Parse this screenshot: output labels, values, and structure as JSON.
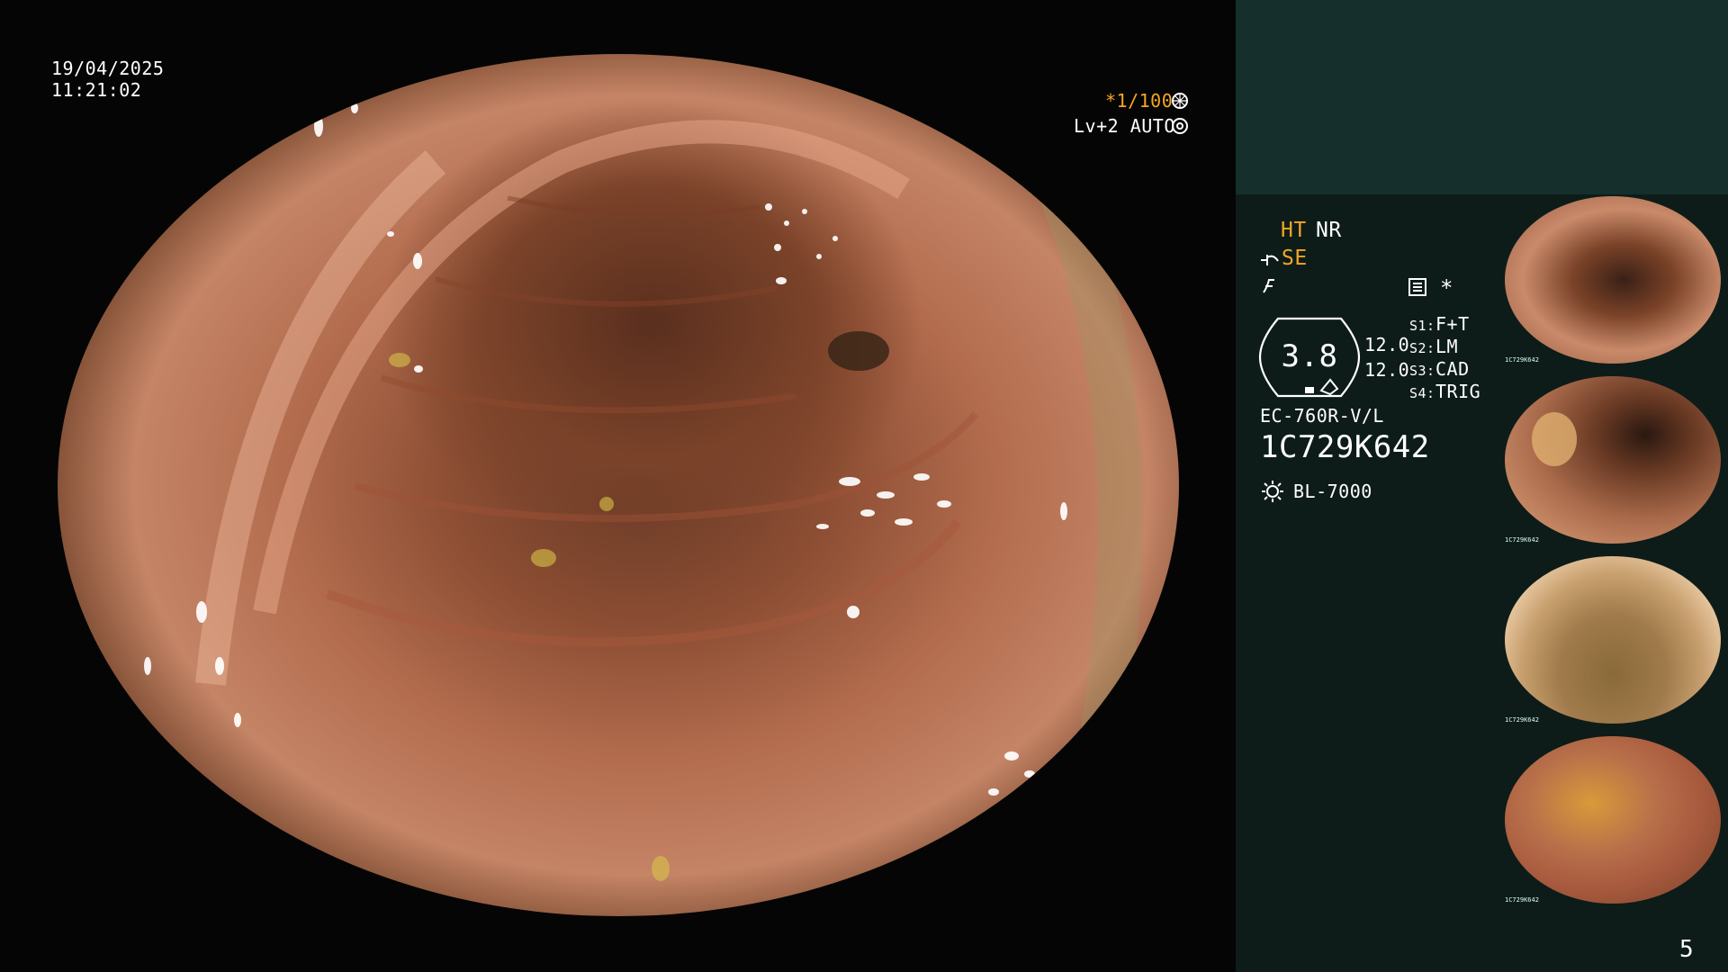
{
  "overlay": {
    "date": "19/04/2025",
    "time": "11:21:02",
    "shutter": "*1/100",
    "shutter_icon": "aperture-icon",
    "level": "Lv+2 AUTO",
    "level_icon": "auto-iris-icon"
  },
  "settings": {
    "ht": "HT",
    "nr": "NR",
    "se": "SE",
    "menu_star": "*",
    "zoom_value": "3.8",
    "value_a": "12.0",
    "value_b": "12.0",
    "s1_key": "S1:",
    "s1_val": "F+T",
    "s2_key": "S2:",
    "s2_val": "LM",
    "s3_key": "S3:",
    "s3_val": "CAD",
    "s4_key": "S4:",
    "s4_val": "TRIG",
    "scope_model": "EC-760R-V/L",
    "scope_serial": "1C729K642",
    "light_source": "BL-7000"
  },
  "thumbnails": [
    {
      "serial": "1C729K642",
      "index": "4"
    },
    {
      "serial": "1C729K642",
      "index": "3"
    },
    {
      "serial": "1C729K642",
      "index": "2"
    },
    {
      "serial": "1C729K642",
      "index": "1"
    }
  ],
  "page_number": "5",
  "colors": {
    "panel_top": "#15302c",
    "panel": "#0d1c19",
    "accent": "#f5a623"
  }
}
